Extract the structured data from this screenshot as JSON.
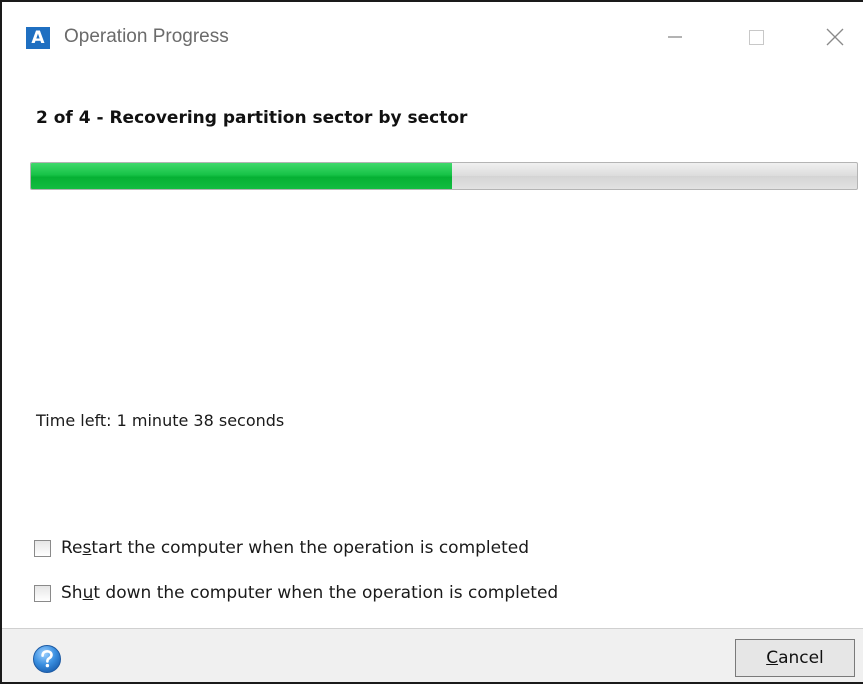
{
  "window": {
    "title": "Operation Progress",
    "app_icon_letter": "A",
    "accent_color": "#1f6fc1"
  },
  "progress": {
    "step_title": "2 of 4 - Recovering partition sector by sector",
    "fraction": 0.51,
    "bar_color": "#17c347",
    "time_left": "Time left: 1 minute 38 seconds"
  },
  "options": [
    {
      "label_pre": "Re",
      "label_accel": "s",
      "label_post": "tart the computer when the operation is completed",
      "checked": false
    },
    {
      "label_pre": "Sh",
      "label_accel": "u",
      "label_post": "t down the computer when the operation is completed",
      "checked": false
    }
  ],
  "footer": {
    "help_icon": "help-icon",
    "cancel_pre": "",
    "cancel_accel": "C",
    "cancel_post": "ancel"
  }
}
